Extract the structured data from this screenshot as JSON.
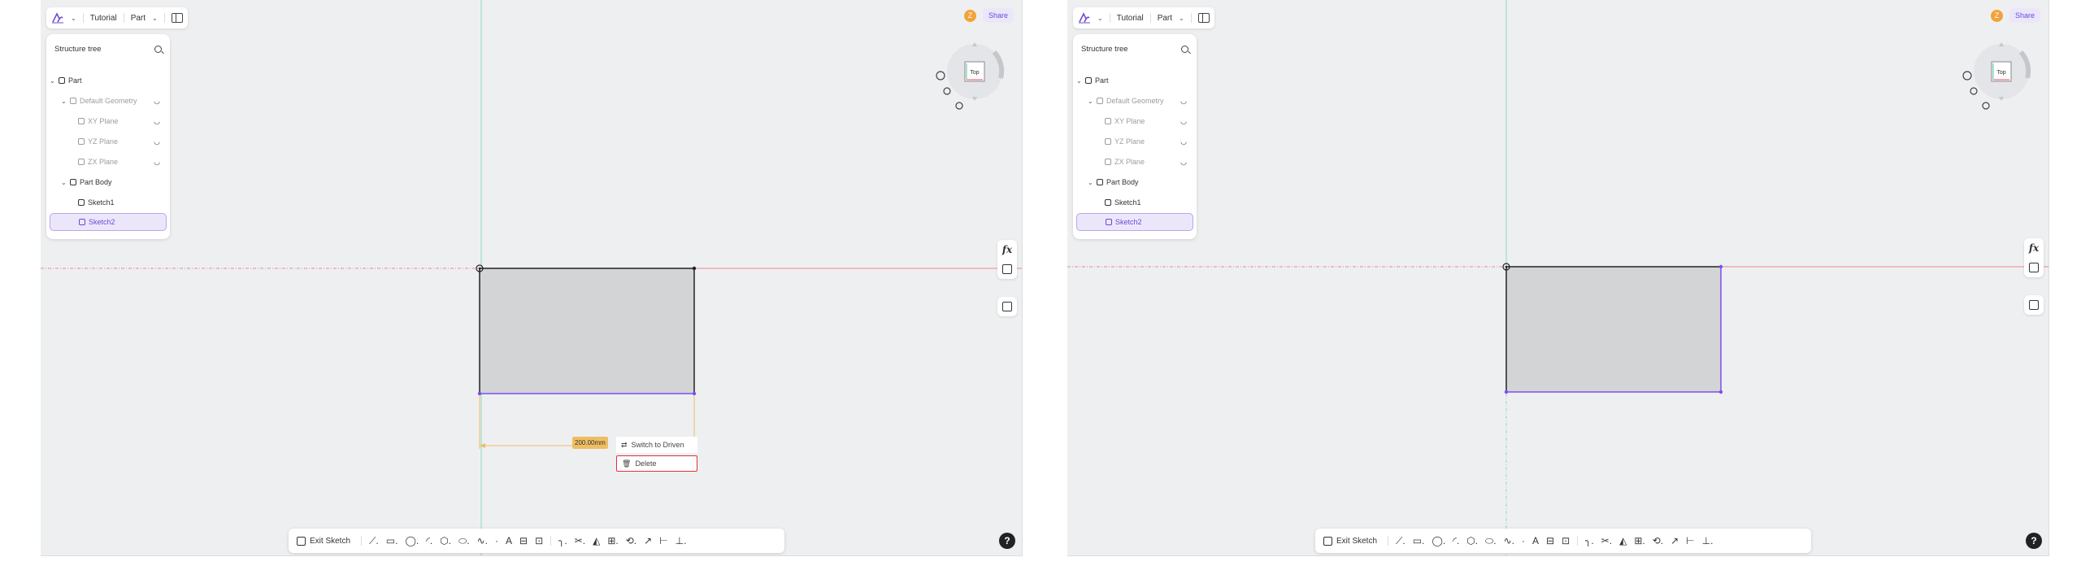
{
  "colors": {
    "canvas_bg": "#eeeff1",
    "accent": "#6d49d6",
    "axis_red": "#ef8a8f",
    "axis_green": "#8fd8c0",
    "sketch_fill": "#d3d4d6",
    "constraint_purple": "#7a4ff0",
    "dimension_orange": "#efbe62",
    "delete_highlight": "#e0313b"
  },
  "left": {
    "topbar": {
      "logo_icon": "app-logo-icon",
      "project": "Tutorial",
      "part_label": "Part",
      "panel_toggle_icon": "sidebar-toggle-icon"
    },
    "tree": {
      "title": "Structure tree",
      "items": [
        "Part",
        "Default Geometry",
        "XY Plane",
        "YZ Plane",
        "ZX Plane",
        "Part Body",
        "Sketch1",
        "Sketch2"
      ]
    },
    "avatar": "Z",
    "share": "Share",
    "navcube_face": "Top",
    "fx": "fx",
    "toolbar": {
      "exit": "Exit Sketch",
      "text_tool": "A"
    },
    "dimension": "200.00mm",
    "context_menu": {
      "switch": "Switch to Driven",
      "delete": "Delete"
    },
    "help": "?"
  },
  "right": {
    "topbar": {
      "logo_icon": "app-logo-icon",
      "project": "Tutorial",
      "part_label": "Part",
      "panel_toggle_icon": "sidebar-toggle-icon"
    },
    "tree": {
      "title": "Structure tree",
      "items": [
        "Part",
        "Default Geometry",
        "XY Plane",
        "YZ Plane",
        "ZX Plane",
        "Part Body",
        "Sketch1",
        "Sketch2"
      ]
    },
    "avatar": "Z",
    "share": "Share",
    "navcube_face": "Top",
    "fx": "fx",
    "toolbar": {
      "exit": "Exit Sketch",
      "text_tool": "A"
    },
    "help": "?"
  }
}
